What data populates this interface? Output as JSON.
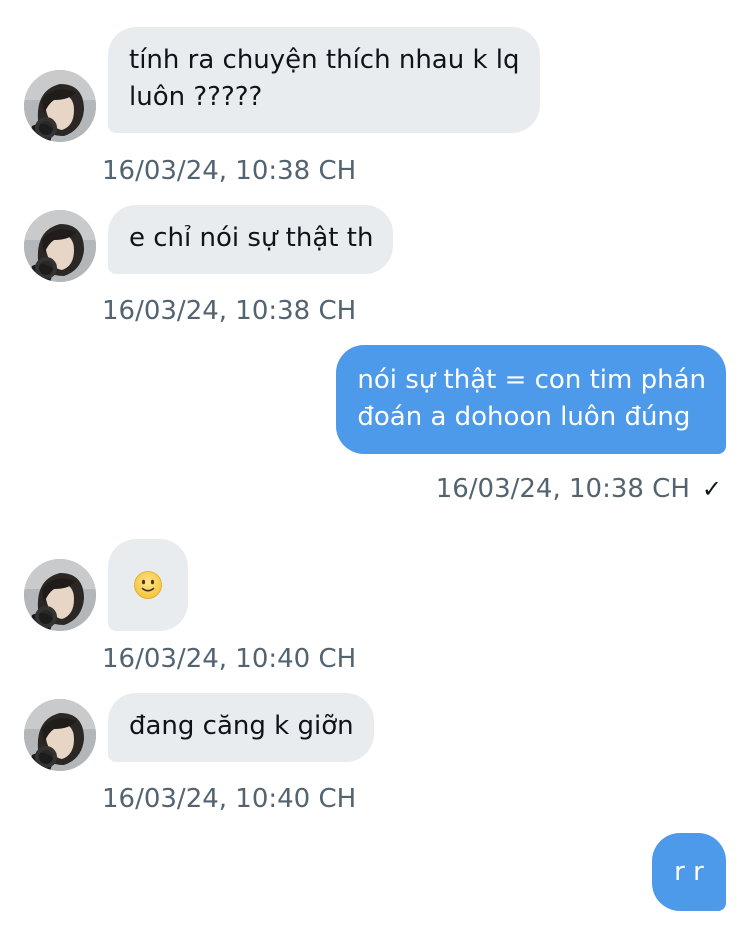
{
  "conversation": {
    "messages": [
      {
        "direction": "in",
        "text": "tính ra chuyện thích nhau k lq\nluôn ?????",
        "timestamp": "16/03/24, 10:38 CH"
      },
      {
        "direction": "in",
        "text": "e chỉ nói sự thật th",
        "timestamp": "16/03/24, 10:38 CH"
      },
      {
        "direction": "out",
        "text": "nói sự thật = con tim phán\nđoán a dohoon luôn đúng",
        "timestamp": "16/03/24, 10:38 CH",
        "status": "✓"
      },
      {
        "direction": "in",
        "emoji": "slightly-smiling-face",
        "timestamp": "16/03/24, 10:40 CH"
      },
      {
        "direction": "in",
        "text": "đang căng k giỡn",
        "timestamp": "16/03/24, 10:40 CH"
      },
      {
        "direction": "out",
        "text": "r r"
      }
    ]
  },
  "colors": {
    "incoming_bubble": "#e9ecef",
    "outgoing_bubble": "#4c9ae9",
    "timestamp_text": "#536471",
    "message_text": "#0f1419"
  },
  "icons": {
    "avatar": "profile-avatar",
    "emoji": "slightly-smiling-face-icon",
    "read_receipt": "checkmark-icon"
  }
}
